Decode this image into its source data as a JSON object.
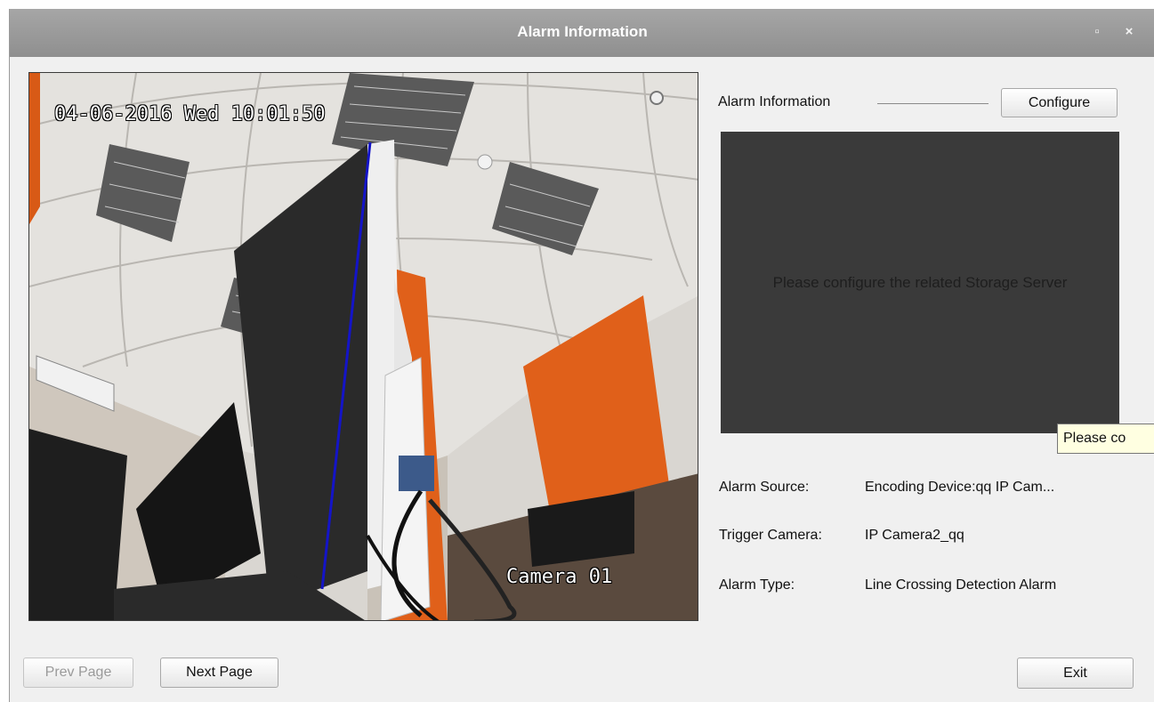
{
  "window": {
    "title": "Alarm Information",
    "minimize_glyph": "▫",
    "close_glyph": "×"
  },
  "video": {
    "timestamp": "04-06-2016 Wed 10:01:50",
    "camera_label": "Camera 01"
  },
  "alarm_info": {
    "section_label": "Alarm Information",
    "configure_label": "Configure",
    "preview_message": "Please configure the related Storage Server",
    "tooltip": "Please co",
    "rows": [
      {
        "label": "Alarm Source:",
        "value": "Encoding Device:qq IP Cam..."
      },
      {
        "label": "Trigger Camera:",
        "value": "IP Camera2_qq"
      },
      {
        "label": "Alarm Type:",
        "value": "Line Crossing Detection Alarm"
      }
    ]
  },
  "footer": {
    "prev_label": "Prev Page",
    "next_label": "Next Page",
    "exit_label": "Exit"
  },
  "colors": {
    "titlebar": "#999999",
    "detection_line": "#1414c8",
    "orange_wall": "#e0601a"
  }
}
